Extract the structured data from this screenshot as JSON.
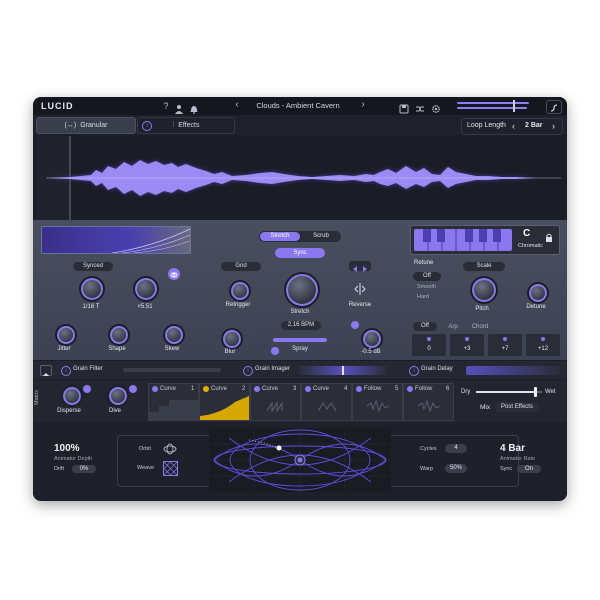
{
  "app": {
    "logo": "LUCID"
  },
  "topbar": {
    "help_icon": "question-icon",
    "user_icon": "user-icon",
    "bell_icon": "bell-icon",
    "prev": "‹",
    "preset_name": "Clouds - Ambient Cavern",
    "next": "›",
    "save_icon": "save-icon",
    "shuffle_icon": "shuffle-icon",
    "settings_icon": "gear-icon"
  },
  "tabs": {
    "granular": "Granular",
    "effects": "Effects",
    "granular_icon": "(↔)",
    "effects_icon": "⫶"
  },
  "loop": {
    "label": "Loop Length",
    "prev": "‹",
    "value": "2 Bar",
    "next": "›"
  },
  "stretch": {
    "mode_a": "Stretch",
    "mode_b": "Scrub",
    "sync": "Sync",
    "synced": "Synced",
    "rate": "1/16 T",
    "mult": "×5.51",
    "jitter": "Jitter",
    "shape": "Shape",
    "skew": "Skew",
    "grid": "Grid",
    "retrigger": "Retrigger",
    "stretch": "Stretch",
    "reverse": "Reverse",
    "bpm": "2.16 BPM",
    "blur": "Blur",
    "spray": "Spray",
    "gain": "-0.5 dB"
  },
  "pitch": {
    "note": "C",
    "scale_name": "Chromatic",
    "retune": "Retune",
    "modes": [
      "Off",
      "Smooth",
      "Hard"
    ],
    "scale": "Scale",
    "pitch": "Pitch",
    "detune": "Detune",
    "chord_modes": [
      "Off",
      "Arp",
      "Chord"
    ],
    "voices": [
      "0",
      "+3",
      "+7",
      "+12"
    ]
  },
  "fx": {
    "grain_filter": "Grain Filter",
    "grain_imager": "Grain Imager",
    "grain_delay": "Grain Delay"
  },
  "matrix": {
    "side_label": "Matrix",
    "disperse": "Disperse",
    "dive": "Dive",
    "slots": [
      {
        "name": "Curve",
        "num": "1"
      },
      {
        "name": "Curve",
        "num": "2"
      },
      {
        "name": "Curve",
        "num": "3"
      },
      {
        "name": "Curve",
        "num": "4"
      },
      {
        "name": "Follow",
        "num": "5"
      },
      {
        "name": "Follow",
        "num": "6"
      }
    ],
    "dry": "Dry",
    "wet": "Wet",
    "mix": "Mix",
    "post": "Post Effects"
  },
  "animator": {
    "depth_value": "100%",
    "depth_label": "Animator Depth",
    "drift_label": "Drift",
    "drift_value": "0%",
    "orbit": "Orbit",
    "weave": "Weave",
    "cycles_label": "Cycles",
    "cycles_value": "4",
    "warp_label": "Warp",
    "warp_value": "50%",
    "rate_value": "4 Bar",
    "rate_label": "Animator Rate",
    "sync_label": "Sync",
    "sync_value": "On"
  },
  "colors": {
    "accent": "#8b78f0",
    "wave": "#7f6bff",
    "bg": "#1b1e27"
  }
}
